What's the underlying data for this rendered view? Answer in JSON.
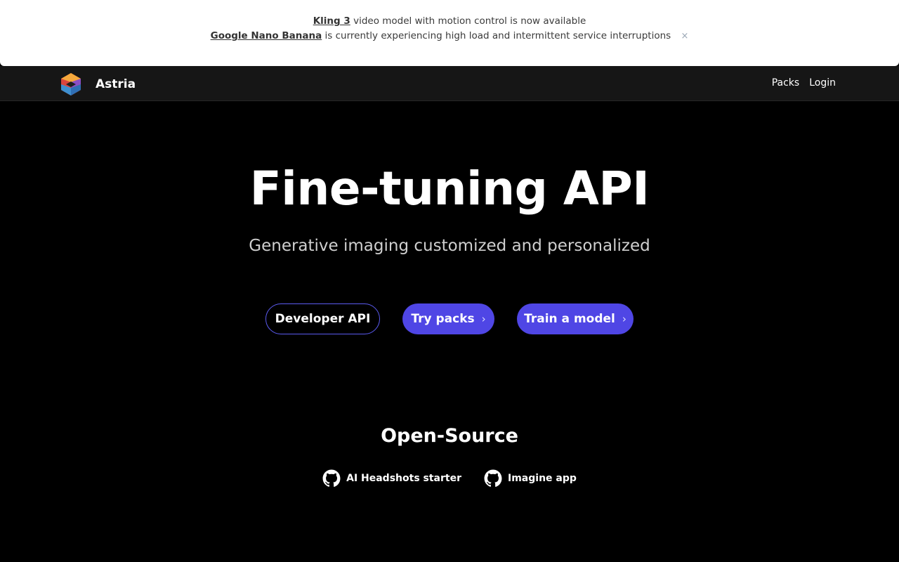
{
  "announcement": {
    "line1_link": "Kling 3",
    "line1_text": "video model with motion control is now available",
    "line2_link": "Google Nano Banana",
    "line2_text": "is currently experiencing high load and intermittent service interruptions",
    "close_glyph": "×"
  },
  "navbar": {
    "brand": "Astria",
    "links": [
      "Packs",
      "Login"
    ]
  },
  "hero": {
    "title": "Fine-tuning API",
    "subtitle": "Generative imaging customized and personalized",
    "buttons": {
      "developer_api": "Developer API",
      "try_packs": "Try packs",
      "train_model": "Train a model"
    }
  },
  "open_source": {
    "title": "Open-Source",
    "links": [
      "AI Headshots starter",
      "Imagine app"
    ]
  },
  "colors": {
    "accent": "#4f46e5",
    "background": "#000000",
    "navbar": "#161616"
  }
}
